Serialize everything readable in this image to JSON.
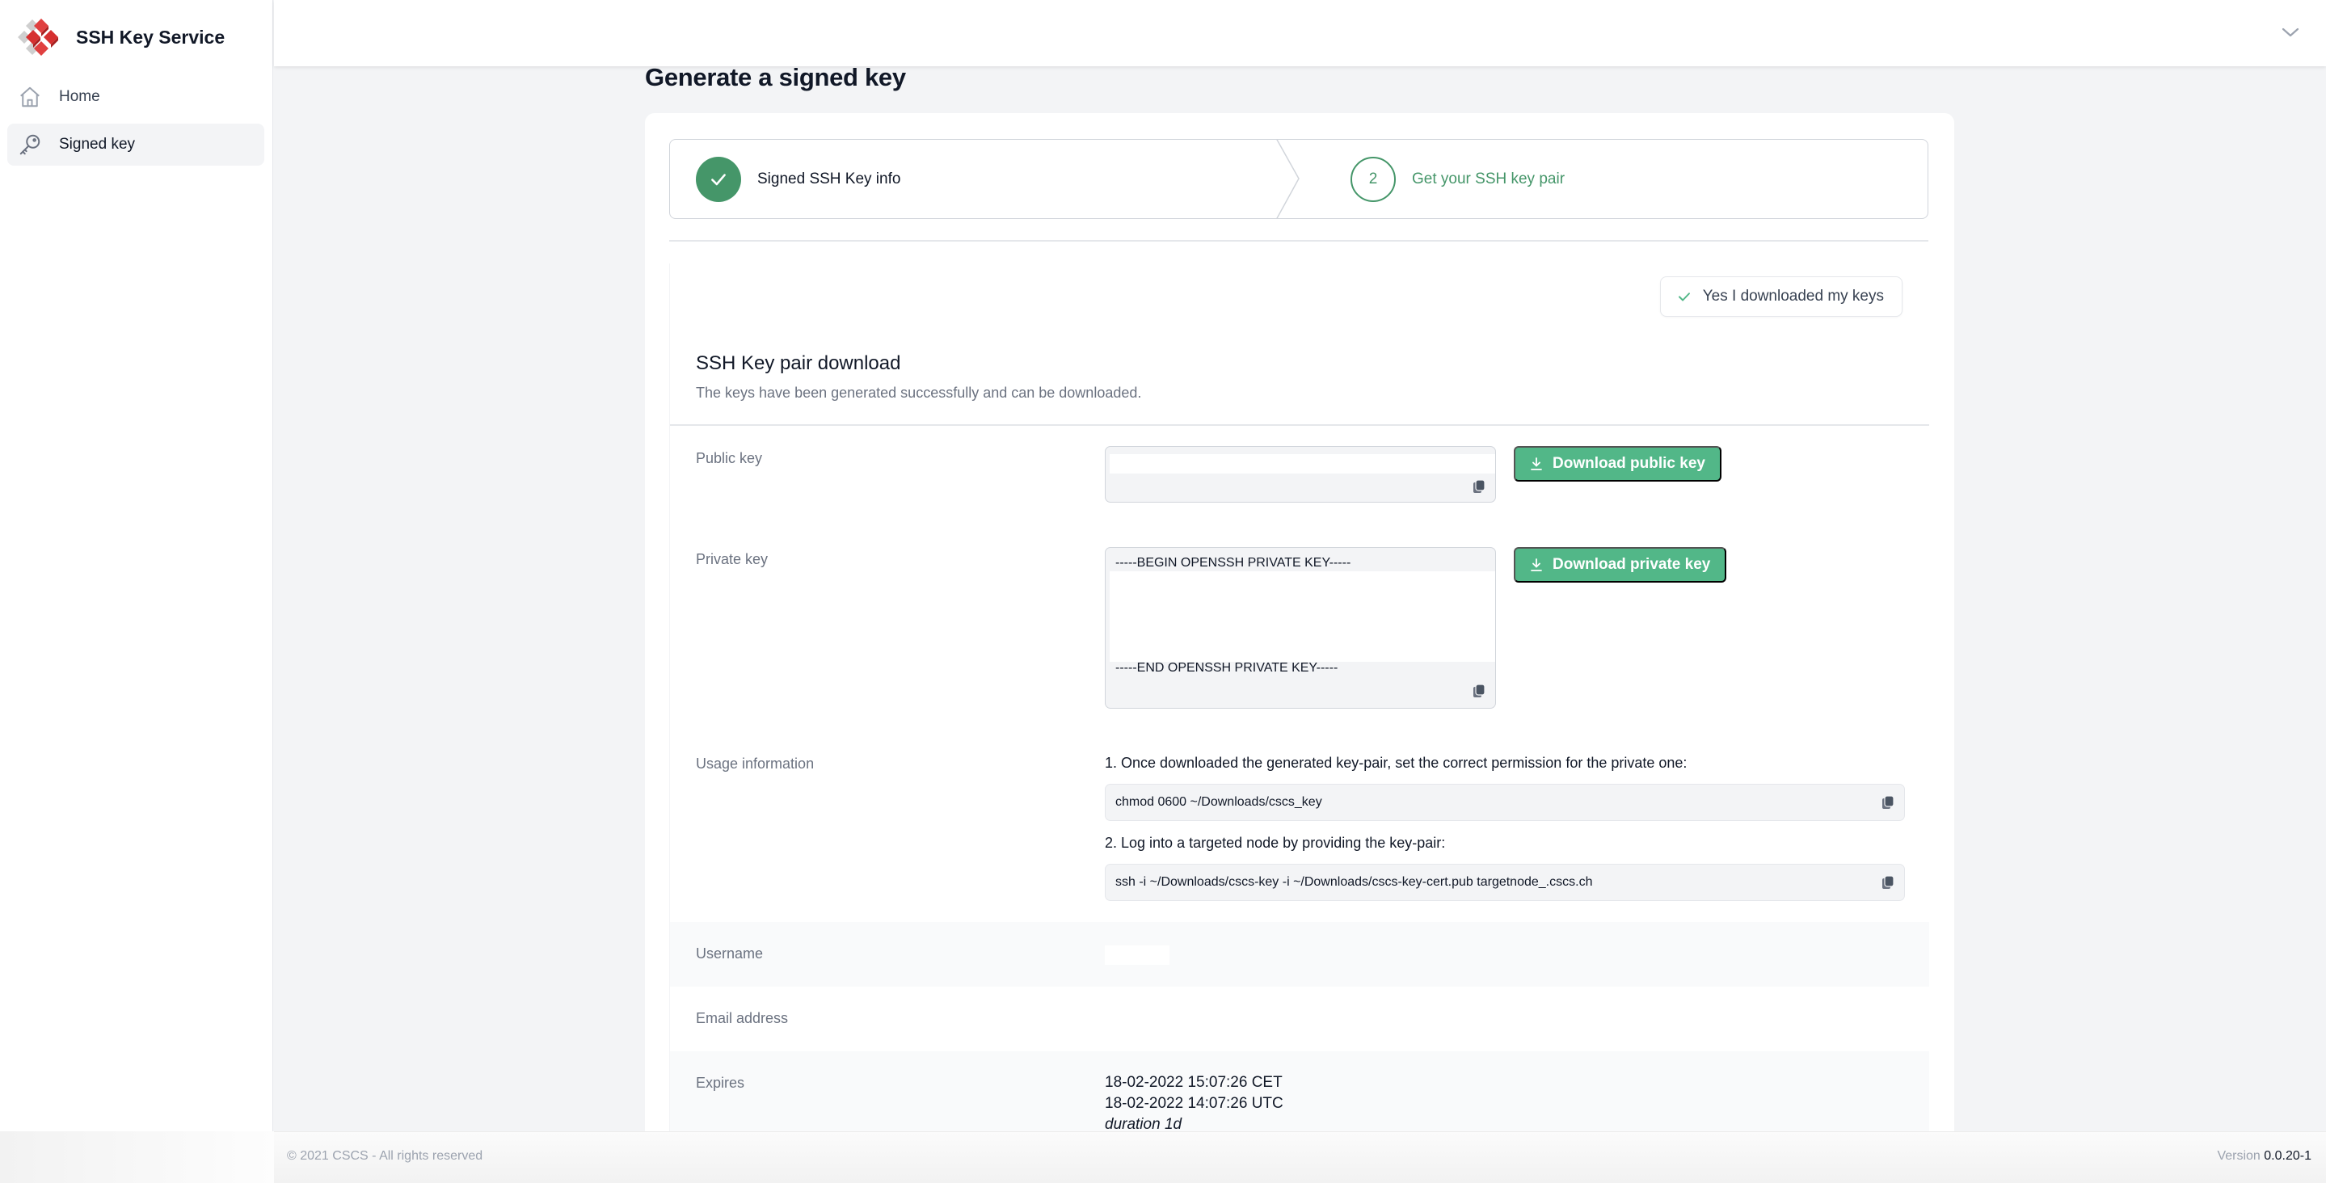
{
  "app": {
    "title": "SSH Key Service"
  },
  "sidebar": {
    "items": [
      {
        "label": "Home",
        "icon": "home-icon",
        "active": false
      },
      {
        "label": "Signed key",
        "icon": "key-icon",
        "active": true
      }
    ]
  },
  "header": {
    "menu_icon": "chevron-down-icon"
  },
  "page": {
    "title": "Generate a signed key"
  },
  "stepper": {
    "steps": [
      {
        "number": "1",
        "label": "Signed SSH Key info",
        "status": "complete"
      },
      {
        "number": "2",
        "label": "Get your SSH key pair",
        "status": "current"
      }
    ]
  },
  "download": {
    "confirm_button": "Yes I downloaded my keys",
    "title": "SSH Key pair download",
    "subtitle": "The keys have been generated successfully and can be downloaded.",
    "public_key": {
      "label": "Public key",
      "value": "",
      "button": "Download public key"
    },
    "private_key": {
      "label": "Private key",
      "begin": "-----BEGIN OPENSSH PRIVATE KEY-----",
      "end": "-----END OPENSSH PRIVATE KEY-----",
      "button": "Download private key"
    },
    "usage": {
      "label": "Usage information",
      "step1": "1. Once downloaded the generated key-pair, set the correct permission for the private one:",
      "cmd1": "chmod 0600 ~/Downloads/cscs_key",
      "step2": "2. Log into a targeted node by providing the key-pair:",
      "cmd2": "ssh -i ~/Downloads/cscs-key -i ~/Downloads/cscs-key-cert.pub targetnode_.cscs.ch"
    },
    "username": {
      "label": "Username",
      "value": ""
    },
    "email": {
      "label": "Email address",
      "value": ""
    },
    "expires": {
      "label": "Expires",
      "local": "18-02-2022 15:07:26 CET",
      "utc": "18-02-2022 14:07:26 UTC",
      "duration": "duration 1d"
    }
  },
  "footer": {
    "copyright": "© 2021 CSCS - All rights reserved",
    "version_label": "Version",
    "version": "0.0.20-1"
  },
  "colors": {
    "accent": "#459669",
    "button": "#52b788",
    "logo_red": "#d32f2f"
  }
}
